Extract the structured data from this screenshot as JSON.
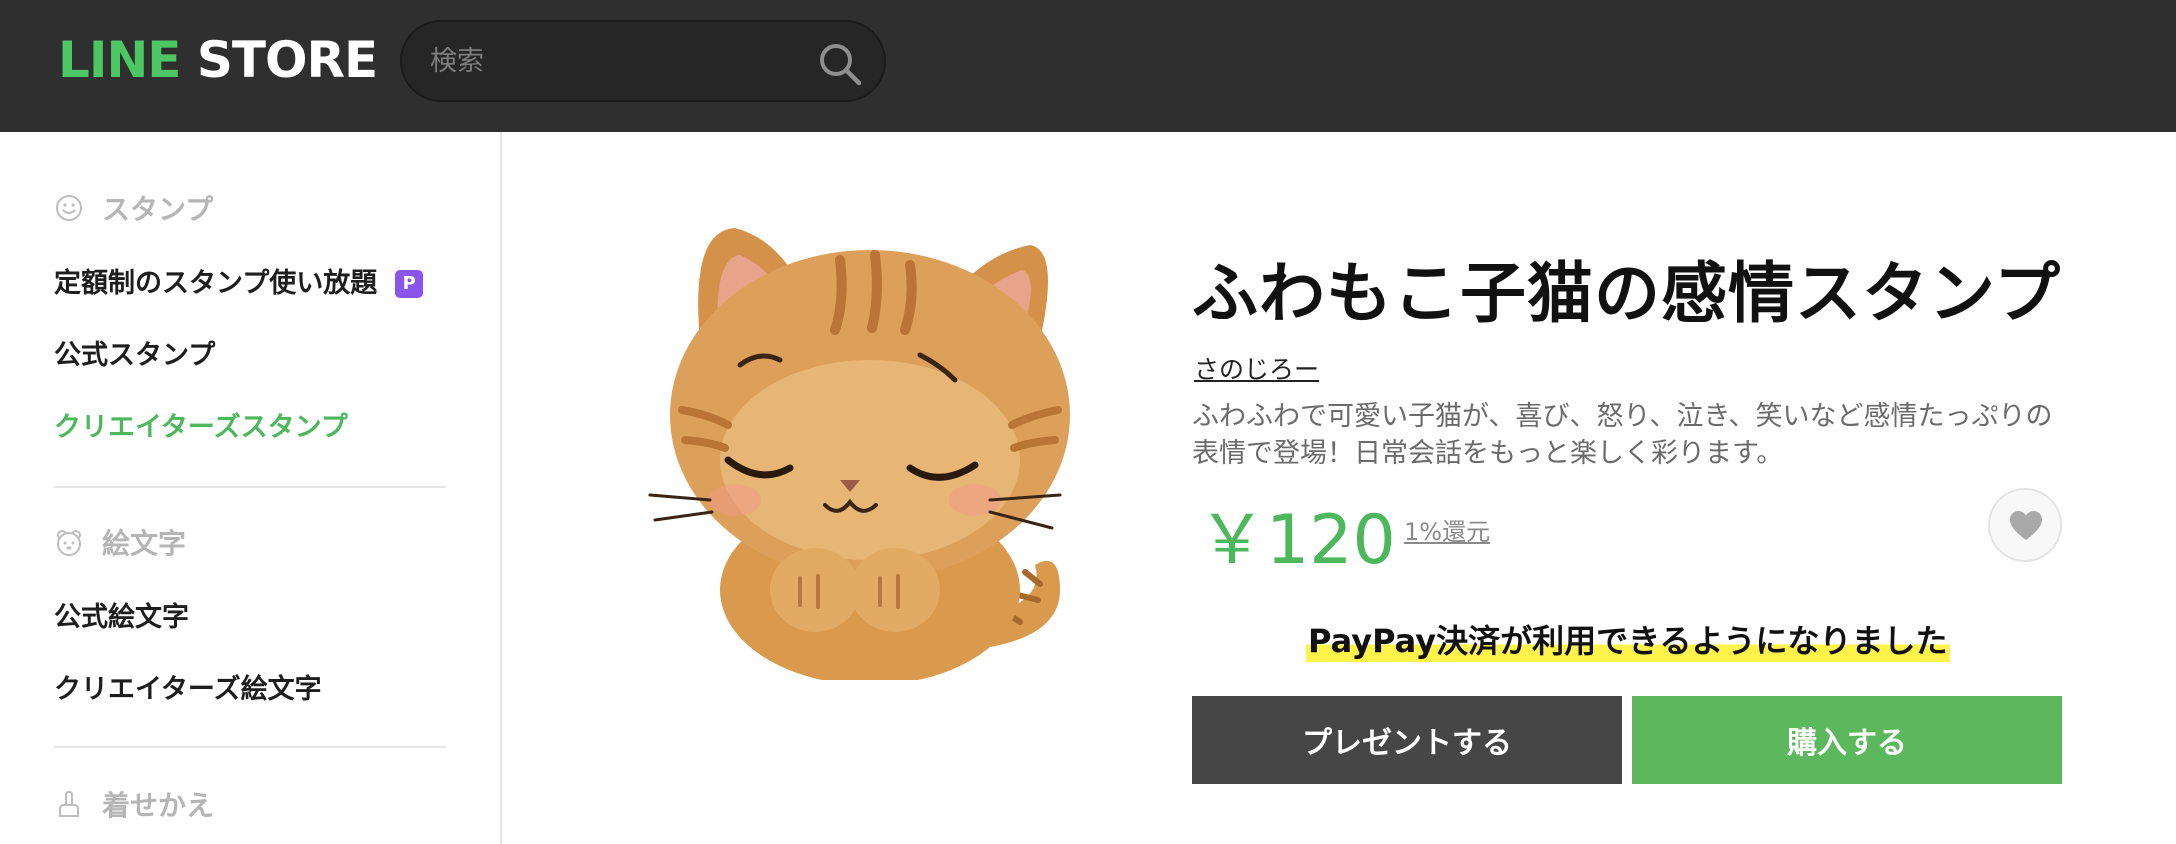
{
  "header": {
    "logo_line": "LINE",
    "logo_store": "STORE",
    "search_placeholder": "検索"
  },
  "sidebar": {
    "sections": [
      {
        "label": "スタンプ",
        "icon": "smile-icon"
      },
      {
        "label": "絵文字",
        "icon": "bear-face-icon"
      },
      {
        "label": "着せかえ",
        "icon": "brush-icon"
      }
    ],
    "items": [
      {
        "label": "定額制のスタンプ使い放題",
        "badge": "P"
      },
      {
        "label": "公式スタンプ"
      },
      {
        "label": "クリエイターズスタンプ",
        "active": true
      },
      {
        "label": "公式絵文字"
      },
      {
        "label": "クリエイターズ絵文字"
      }
    ]
  },
  "product": {
    "title": "ふわもこ子猫の感情スタンプ",
    "author": "さのじろー",
    "description": "ふわふわで可愛い子猫が、喜び、怒り、泣き、笑いなど感情たっぷりの表情で登場！日常会話をもっと楽しく彩ります。",
    "price": "￥120",
    "cashback": "1%還元",
    "paypay_notice": "PayPay決済が利用できるようになりました",
    "gift_button": "プレゼントする",
    "buy_button": "購入する"
  },
  "colors": {
    "header_bg": "#2f2f2f",
    "brand_green": "#4cc764",
    "accent_green": "#4cb85b",
    "buy_button": "#5cb85c",
    "gift_button": "#464646",
    "badge_purple": "#8a55e8",
    "highlight_yellow": "#fff24a"
  }
}
